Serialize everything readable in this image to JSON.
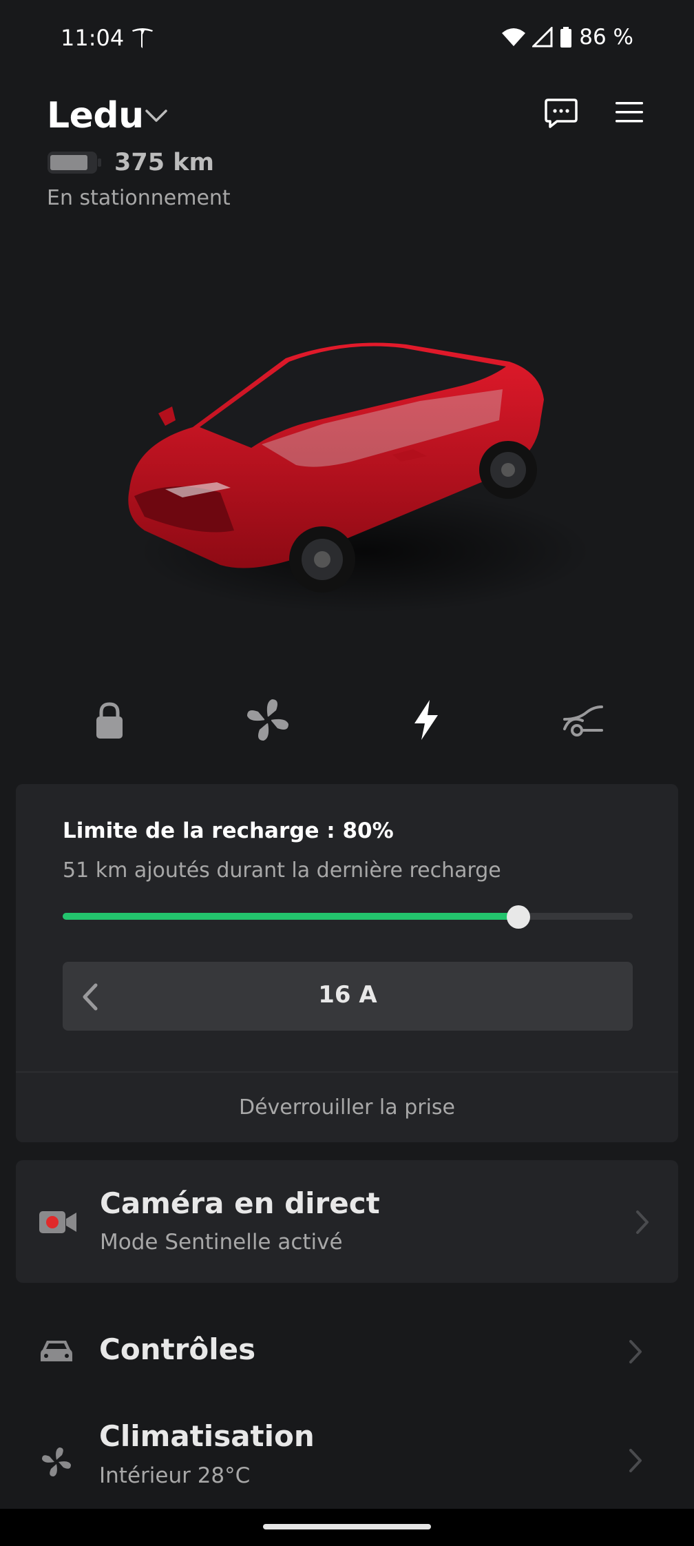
{
  "status_bar": {
    "time": "11:04",
    "battery_percent": "86 %",
    "icons": [
      "tesla-logo-icon",
      "wifi-icon",
      "cell-signal-icon",
      "battery-icon"
    ]
  },
  "header": {
    "vehicle_name": "Ledu",
    "range": "375 km",
    "status": "En stationnement"
  },
  "quick_actions": [
    {
      "icon": "lock-icon"
    },
    {
      "icon": "fan-icon"
    },
    {
      "icon": "lightning-icon",
      "active": true
    },
    {
      "icon": "vent-icon"
    }
  ],
  "charging": {
    "limit_text": "Limite de la recharge : 80%",
    "added_text": "51 km ajoutés durant la dernière recharge",
    "limit_fraction": 0.8,
    "amperage": "16 A",
    "unlock_port": "Déverrouiller la prise"
  },
  "camera": {
    "title": "Caméra en direct",
    "subtitle": "Mode Sentinelle activé"
  },
  "menu": {
    "controls": "Contrôles",
    "climate": "Climatisation",
    "climate_sub": "Intérieur 28°C"
  },
  "colors": {
    "background": "#18191b",
    "card": "#232427",
    "accent_green": "#23c46d",
    "car_red": "#c8101e",
    "recording_red": "#e02a2a"
  }
}
